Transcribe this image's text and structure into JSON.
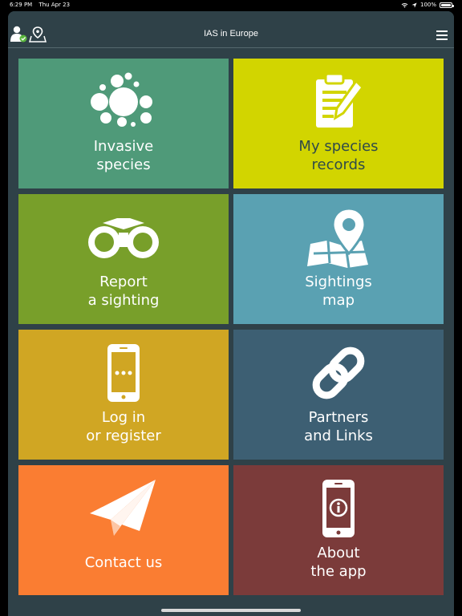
{
  "status": {
    "time": "6:29 PM",
    "date": "Thu Apr 23",
    "battery": "100%"
  },
  "header": {
    "title": "IAS in Europe"
  },
  "tiles": [
    {
      "label": "Invasive\nspecies",
      "color": "#4f9a79",
      "icon": "circles-icon"
    },
    {
      "label": "My species\nrecords",
      "color": "#d2d500",
      "text_color": "#2f4a4a",
      "icon": "clipboard-icon"
    },
    {
      "label": "Report\na sighting",
      "color": "#789f2a",
      "icon": "binoculars-icon"
    },
    {
      "label": "Sightings\nmap",
      "color": "#5aa1b2",
      "icon": "map-pin-icon"
    },
    {
      "label": "Log in\nor register",
      "color": "#d0a623",
      "icon": "phone-icon"
    },
    {
      "label": "Partners\nand Links",
      "color": "#3d5f73",
      "icon": "link-icon"
    },
    {
      "label": "Contact us",
      "color": "#fa7d32",
      "icon": "paper-plane-icon"
    },
    {
      "label": "About\nthe app",
      "color": "#7b3b3a",
      "icon": "info-phone-icon"
    }
  ]
}
